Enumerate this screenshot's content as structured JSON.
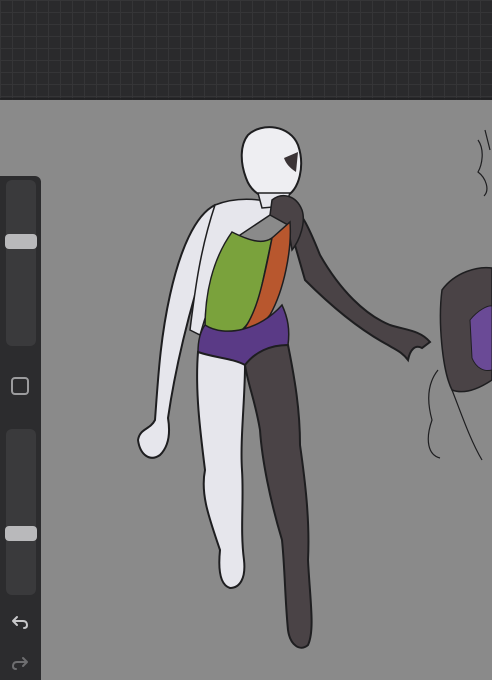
{
  "app": "Procreate",
  "top_bar": {
    "style": "grid"
  },
  "sidebar": {
    "size_slider": {
      "level": 0.65
    },
    "opacity_slider": {
      "level": 0.35
    },
    "modify_button": {
      "icon": "square-icon"
    },
    "undo": {
      "icon": "undo-icon"
    },
    "redo": {
      "icon": "redo-icon"
    }
  },
  "canvas": {
    "background": "#8a8a8a",
    "artwork": "figure-sketch",
    "colors": {
      "white_body": "#e6e6ec",
      "dark_body": "#4a4346",
      "green": "#7aa23c",
      "orange": "#b8572e",
      "purple": "#5a3a86",
      "outline": "#1e1e20"
    }
  }
}
